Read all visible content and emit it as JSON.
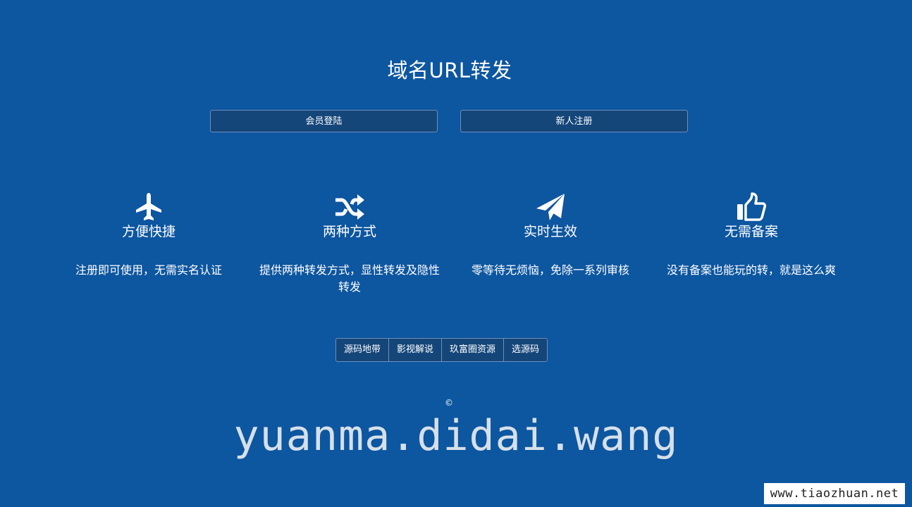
{
  "title": "域名URL转发",
  "buttons": {
    "login": "会员登陆",
    "register": "新人注册"
  },
  "features": [
    {
      "icon": "airplane-icon",
      "title": "方便快捷",
      "desc": "注册即可使用，无需实名认证"
    },
    {
      "icon": "shuffle-icon",
      "title": "两种方式",
      "desc": "提供两种转发方式，显性转发及隐性转发"
    },
    {
      "icon": "paper-plane-icon",
      "title": "实时生效",
      "desc": "零等待无烦恼，免除一系列审核"
    },
    {
      "icon": "thumbs-up-icon",
      "title": "无需备案",
      "desc": "没有备案也能玩的转，就是这么爽"
    }
  ],
  "links": [
    "源码地带",
    "影视解说",
    "玖富圈资源",
    "选源码"
  ],
  "copyright": "©",
  "watermark": "yuanma.didai.wang",
  "badge": "www.tiaozhuan.net",
  "colors": {
    "background": "#0d56a0",
    "button_bg": "#15467a",
    "button_border": "#6d8fb8"
  }
}
